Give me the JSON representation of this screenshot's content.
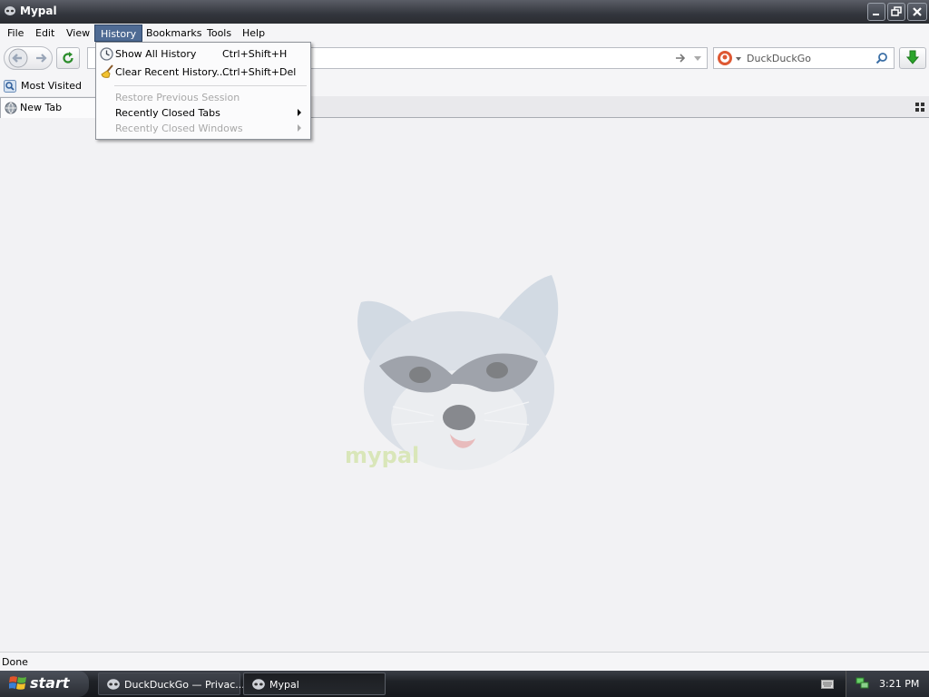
{
  "window": {
    "title": "Mypal"
  },
  "menubar": {
    "items": [
      {
        "label": "File"
      },
      {
        "label": "Edit"
      },
      {
        "label": "View"
      },
      {
        "label": "History"
      },
      {
        "label": "Bookmarks"
      },
      {
        "label": "Tools"
      },
      {
        "label": "Help"
      }
    ]
  },
  "history_menu": {
    "items": [
      {
        "label": "Show All History",
        "shortcut": "Ctrl+Shift+H",
        "icon": "clock-icon",
        "enabled": true
      },
      {
        "label": "Clear Recent History...",
        "shortcut": "Ctrl+Shift+Del",
        "icon": "broom-icon",
        "enabled": true
      },
      {
        "label": "Restore Previous Session",
        "shortcut": "",
        "enabled": false
      },
      {
        "label": "Recently Closed Tabs",
        "shortcut": "",
        "submenu": true,
        "enabled": true
      },
      {
        "label": "Recently Closed Windows",
        "shortcut": "",
        "submenu": true,
        "enabled": false
      }
    ]
  },
  "search": {
    "engine": "DuckDuckGo",
    "placeholder": "DuckDuckGo"
  },
  "bookmarks_toolbar": {
    "items": [
      {
        "label": "Most Visited"
      }
    ]
  },
  "tabs": [
    {
      "label": "New Tab"
    }
  ],
  "status": {
    "text": "Done"
  },
  "taskbar": {
    "start_label": "start",
    "tasks": [
      {
        "label": "DuckDuckGo — Privac..."
      },
      {
        "label": "Mypal"
      }
    ],
    "clock": "3:21 PM"
  },
  "content": {
    "logo_text": "mypal"
  },
  "colors": {
    "accent": "#4f6b94",
    "download": "#2aa52a"
  }
}
